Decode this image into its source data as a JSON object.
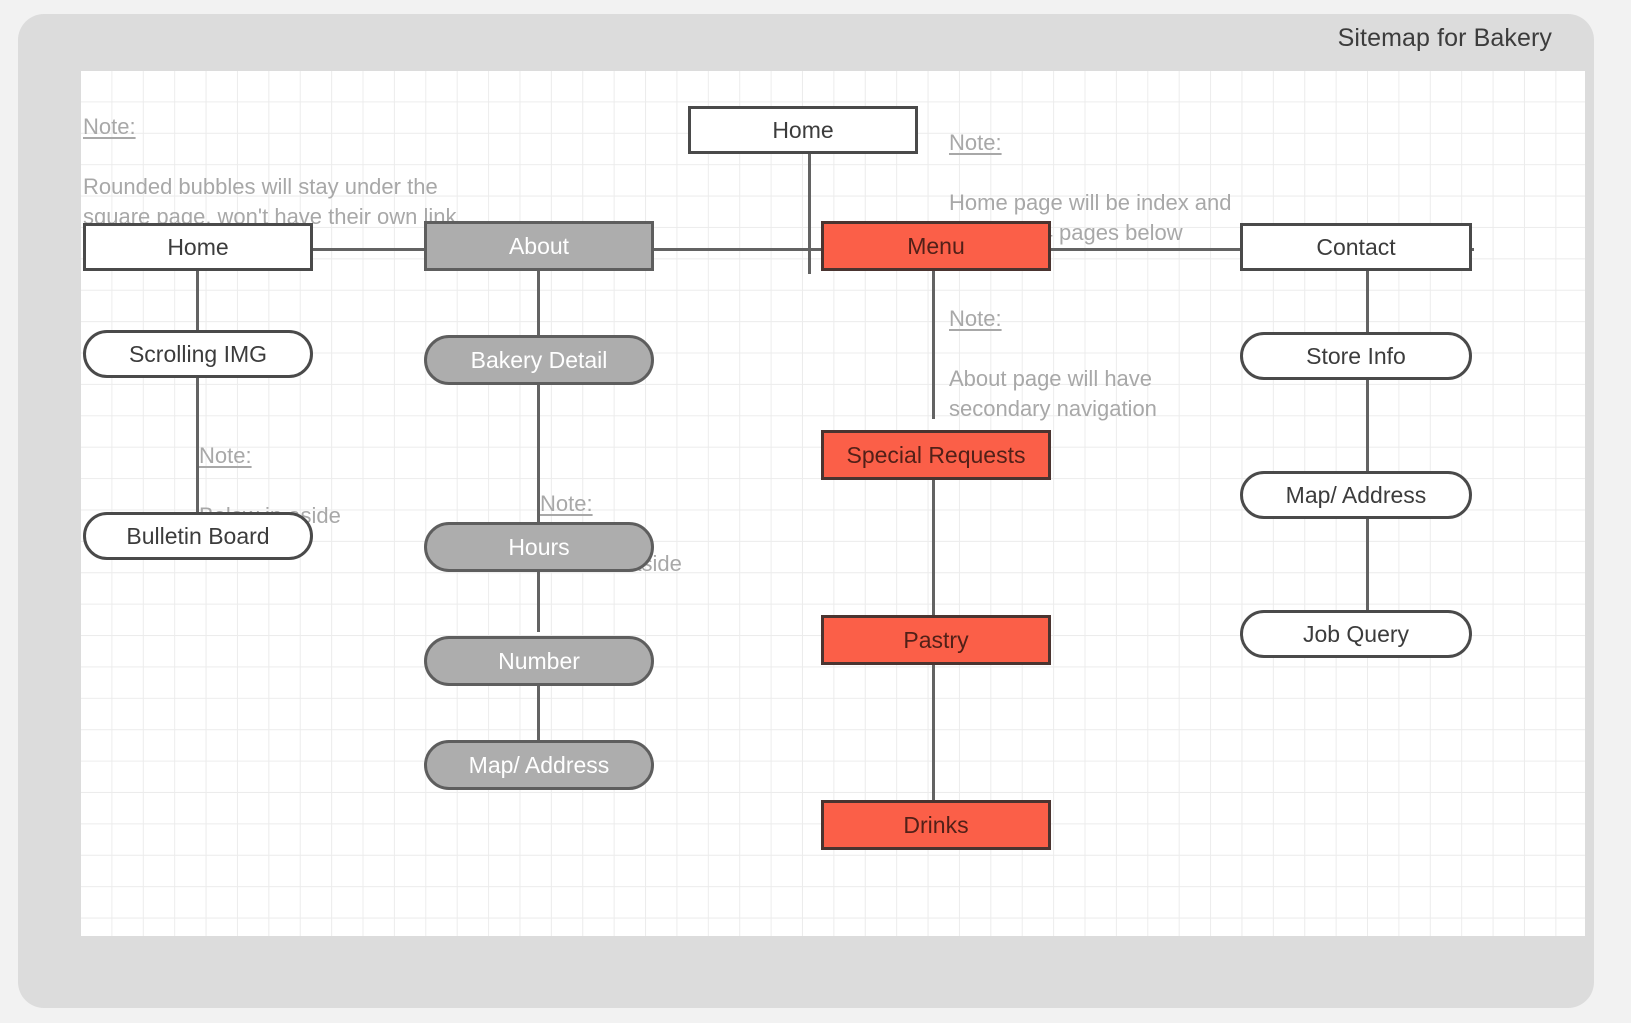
{
  "header": {
    "title": "Sitemap for Bakery"
  },
  "legend": {
    "colors": {
      "page_white_fill": "#ffffff",
      "bubble_gray_fill": "#adadad",
      "page_orange_fill": "#fb5f48",
      "border": "#4a4a4a",
      "connector": "#636363",
      "note_text": "#a8a8a8",
      "frame": "#dcdcdc",
      "canvas": "#ffffff",
      "grid_line": "#ececec"
    }
  },
  "notes": [
    {
      "id": "note-bubbles",
      "head": "Note:",
      "body": "Rounded bubbles will stay under the\nsquare page, won't have their own link"
    },
    {
      "id": "note-home-index",
      "head": "Note:",
      "body": "Home page will be index and\nlink to all 4 pages below"
    },
    {
      "id": "note-home-aside",
      "head": "Note:",
      "body": "Below in aside"
    },
    {
      "id": "note-about-aside",
      "head": "Note:",
      "body": "Below in aside"
    },
    {
      "id": "note-secondary-nav",
      "head": "Note:",
      "body": "About page will have\nsecondary navigation"
    }
  ],
  "nodes": {
    "root": {
      "label": "Home",
      "shape": "page",
      "skin": "white"
    },
    "columns": [
      {
        "id": "home",
        "head": {
          "label": "Home",
          "shape": "page",
          "skin": "white"
        },
        "children": [
          {
            "label": "Scrolling IMG",
            "shape": "bubble",
            "skin": "white"
          },
          {
            "label": "Bulletin Board",
            "shape": "bubble",
            "skin": "white"
          }
        ]
      },
      {
        "id": "about",
        "head": {
          "label": "About",
          "shape": "page",
          "skin": "gray"
        },
        "children": [
          {
            "label": "Bakery Detail",
            "shape": "bubble",
            "skin": "gray"
          },
          {
            "label": "Hours",
            "shape": "bubble",
            "skin": "gray"
          },
          {
            "label": "Number",
            "shape": "bubble",
            "skin": "gray"
          },
          {
            "label": "Map/ Address",
            "shape": "bubble",
            "skin": "gray"
          }
        ]
      },
      {
        "id": "menu",
        "head": {
          "label": "Menu",
          "shape": "page",
          "skin": "orange"
        },
        "children": [
          {
            "label": "Special Requests",
            "shape": "page",
            "skin": "orange"
          },
          {
            "label": "Pastry",
            "shape": "page",
            "skin": "orange"
          },
          {
            "label": "Drinks",
            "shape": "page",
            "skin": "orange"
          }
        ]
      },
      {
        "id": "contact",
        "head": {
          "label": "Contact",
          "shape": "page",
          "skin": "white"
        },
        "children": [
          {
            "label": "Store Info",
            "shape": "bubble",
            "skin": "white"
          },
          {
            "label": "Map/ Address",
            "shape": "bubble",
            "skin": "white"
          },
          {
            "label": "Job Query",
            "shape": "bubble",
            "skin": "white"
          }
        ]
      }
    ]
  }
}
